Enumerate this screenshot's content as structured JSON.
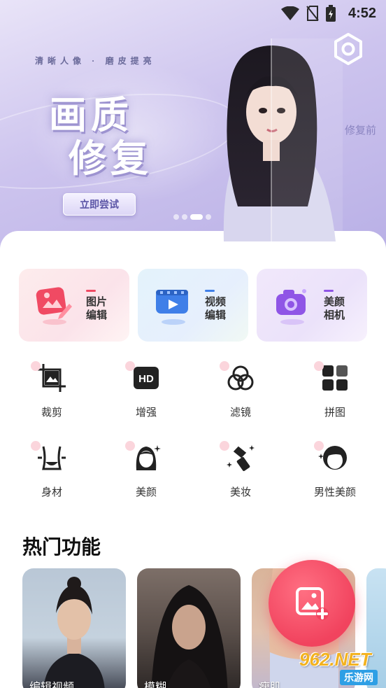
{
  "status_bar": {
    "time": "4:52"
  },
  "banner": {
    "tagline": "清晰人像 · 磨皮提亮",
    "title_line1": "画质",
    "title_line2": "修复",
    "try_button": "立即尝试",
    "compare_label": "修复前",
    "page_count": 4,
    "active_page": 3
  },
  "feature_cards": [
    {
      "label": "图片编辑",
      "accent": "#f04a63"
    },
    {
      "label": "视频编辑",
      "accent": "#3f7fe8"
    },
    {
      "label": "美颜相机",
      "accent": "#8f55e6"
    }
  ],
  "tools": [
    {
      "label": "裁剪",
      "icon": "crop-icon"
    },
    {
      "label": "增强",
      "icon": "hd-icon"
    },
    {
      "label": "滤镜",
      "icon": "filter-icon"
    },
    {
      "label": "拼图",
      "icon": "collage-icon"
    },
    {
      "label": "身材",
      "icon": "body-icon"
    },
    {
      "label": "美颜",
      "icon": "beauty-face-icon"
    },
    {
      "label": "美妆",
      "icon": "lipstick-icon"
    },
    {
      "label": "男性美颜",
      "icon": "male-face-icon"
    }
  ],
  "hot": {
    "title": "热门功能",
    "items": [
      {
        "label": "编辑视频"
      },
      {
        "label": "模糊"
      },
      {
        "label": "瘦肌"
      },
      {
        "label": ""
      }
    ]
  },
  "fab": {
    "icon": "add-photo-icon"
  },
  "watermark": {
    "top": "962.NET",
    "bottom": "乐游网"
  }
}
